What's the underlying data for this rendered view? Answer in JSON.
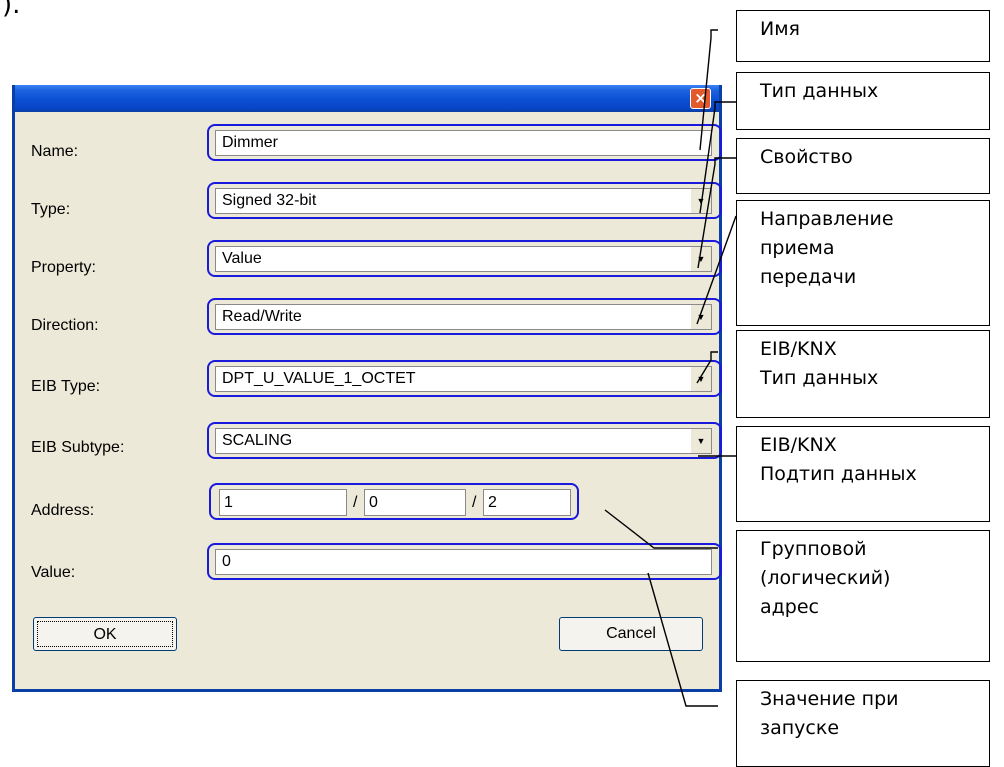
{
  "corner_char": ").",
  "dialog": {
    "close_glyph": "×",
    "fields": {
      "name": {
        "label": "Name:",
        "value": "Dimmer"
      },
      "type": {
        "label": "Type:",
        "value": "Signed 32-bit"
      },
      "property": {
        "label": "Property:",
        "value": "Value"
      },
      "direction": {
        "label": "Direction:",
        "value": "Read/Write"
      },
      "eib_type": {
        "label": "EIB Type:",
        "value": "DPT_U_VALUE_1_OCTET"
      },
      "eib_subtype": {
        "label": "EIB Subtype:",
        "value": "SCALING"
      },
      "address": {
        "label": "Address:",
        "main": "1",
        "middle": "0",
        "sub": "2",
        "separator": "/"
      },
      "value": {
        "label": "Value:",
        "value": "0"
      }
    },
    "buttons": {
      "ok": "OK",
      "cancel": "Cancel"
    }
  },
  "callouts": [
    {
      "lines": [
        "Имя"
      ]
    },
    {
      "lines": [
        "Тип данных"
      ]
    },
    {
      "lines": [
        "Свойство"
      ]
    },
    {
      "lines": [
        "Направление",
        "приема",
        "передачи"
      ]
    },
    {
      "lines": [
        "EIB/KNX",
        "Тип данных"
      ]
    },
    {
      "lines": [
        "EIB/KNX",
        "Подтип данных"
      ]
    },
    {
      "lines": [
        "Групповой",
        "(логический)",
        "адрес"
      ]
    },
    {
      "lines": [
        "Значение при",
        "запуске"
      ]
    }
  ]
}
